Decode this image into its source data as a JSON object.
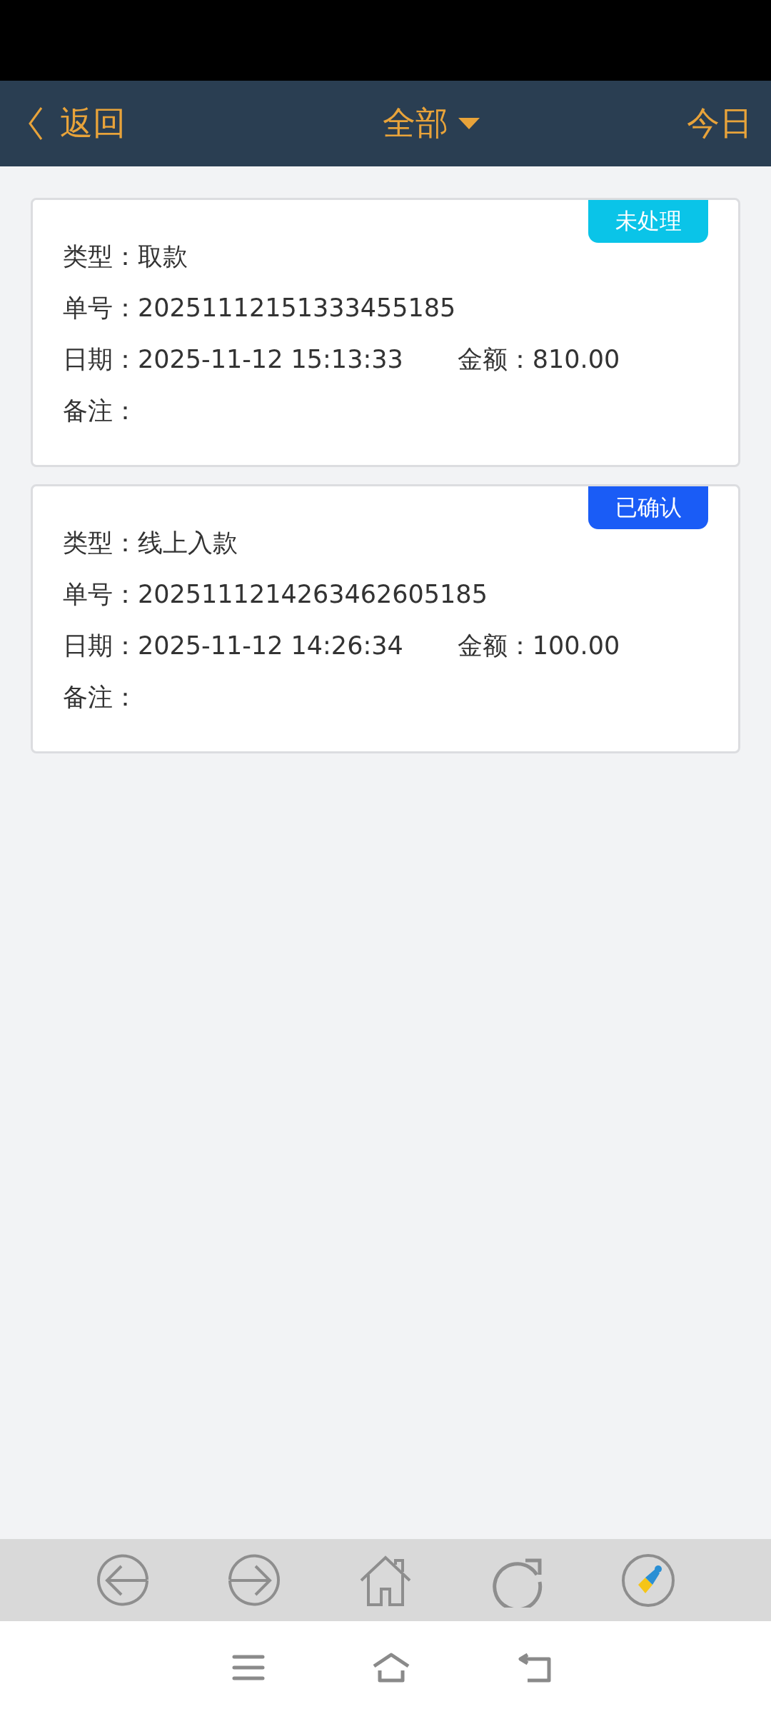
{
  "header": {
    "back": "返回",
    "title": "全部",
    "right": "今日"
  },
  "records": [
    {
      "badge": {
        "label": "未处理",
        "color": "#0ac4e8"
      },
      "fields": [
        {
          "label": "类型：",
          "value": "取款"
        },
        {
          "label": "单号：",
          "value": "20251112151333455185"
        }
      ],
      "date": {
        "label": "日期：",
        "value": "2025-11-12 15:13:33"
      },
      "amount": {
        "label": "金额：",
        "value": "810.00"
      },
      "note": {
        "label": "备注："
      }
    },
    {
      "badge": {
        "label": "已确认",
        "color": "#1a5cf6"
      },
      "fields": [
        {
          "label": "类型：",
          "value": "线上入款"
        },
        {
          "label": "单号：",
          "value": "2025111214263462605185"
        }
      ],
      "date": {
        "label": "日期：",
        "value": "2025-11-12 14:26:34"
      },
      "amount": {
        "label": "金额：",
        "value": "100.00"
      },
      "note": {
        "label": "备注："
      }
    }
  ]
}
